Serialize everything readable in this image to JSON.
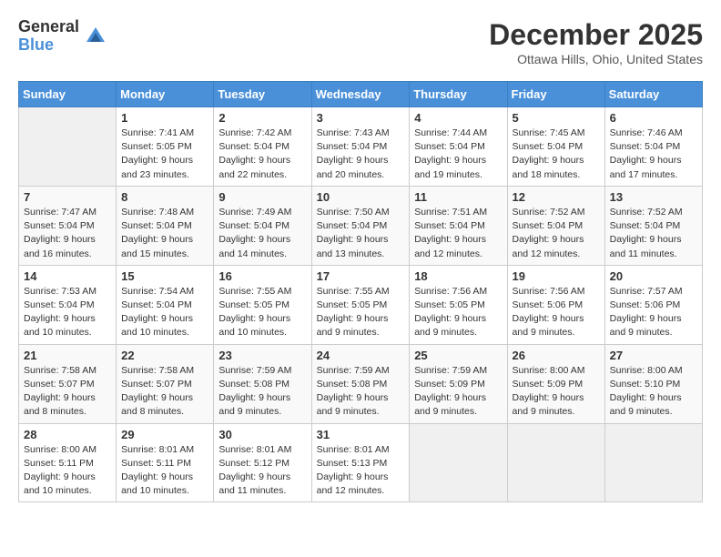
{
  "logo": {
    "general": "General",
    "blue": "Blue"
  },
  "title": "December 2025",
  "location": "Ottawa Hills, Ohio, United States",
  "weekdays": [
    "Sunday",
    "Monday",
    "Tuesday",
    "Wednesday",
    "Thursday",
    "Friday",
    "Saturday"
  ],
  "weeks": [
    [
      {
        "day": "",
        "info": ""
      },
      {
        "day": "1",
        "info": "Sunrise: 7:41 AM\nSunset: 5:05 PM\nDaylight: 9 hours\nand 23 minutes."
      },
      {
        "day": "2",
        "info": "Sunrise: 7:42 AM\nSunset: 5:04 PM\nDaylight: 9 hours\nand 22 minutes."
      },
      {
        "day": "3",
        "info": "Sunrise: 7:43 AM\nSunset: 5:04 PM\nDaylight: 9 hours\nand 20 minutes."
      },
      {
        "day": "4",
        "info": "Sunrise: 7:44 AM\nSunset: 5:04 PM\nDaylight: 9 hours\nand 19 minutes."
      },
      {
        "day": "5",
        "info": "Sunrise: 7:45 AM\nSunset: 5:04 PM\nDaylight: 9 hours\nand 18 minutes."
      },
      {
        "day": "6",
        "info": "Sunrise: 7:46 AM\nSunset: 5:04 PM\nDaylight: 9 hours\nand 17 minutes."
      }
    ],
    [
      {
        "day": "7",
        "info": "Sunrise: 7:47 AM\nSunset: 5:04 PM\nDaylight: 9 hours\nand 16 minutes."
      },
      {
        "day": "8",
        "info": "Sunrise: 7:48 AM\nSunset: 5:04 PM\nDaylight: 9 hours\nand 15 minutes."
      },
      {
        "day": "9",
        "info": "Sunrise: 7:49 AM\nSunset: 5:04 PM\nDaylight: 9 hours\nand 14 minutes."
      },
      {
        "day": "10",
        "info": "Sunrise: 7:50 AM\nSunset: 5:04 PM\nDaylight: 9 hours\nand 13 minutes."
      },
      {
        "day": "11",
        "info": "Sunrise: 7:51 AM\nSunset: 5:04 PM\nDaylight: 9 hours\nand 12 minutes."
      },
      {
        "day": "12",
        "info": "Sunrise: 7:52 AM\nSunset: 5:04 PM\nDaylight: 9 hours\nand 12 minutes."
      },
      {
        "day": "13",
        "info": "Sunrise: 7:52 AM\nSunset: 5:04 PM\nDaylight: 9 hours\nand 11 minutes."
      }
    ],
    [
      {
        "day": "14",
        "info": "Sunrise: 7:53 AM\nSunset: 5:04 PM\nDaylight: 9 hours\nand 10 minutes."
      },
      {
        "day": "15",
        "info": "Sunrise: 7:54 AM\nSunset: 5:04 PM\nDaylight: 9 hours\nand 10 minutes."
      },
      {
        "day": "16",
        "info": "Sunrise: 7:55 AM\nSunset: 5:05 PM\nDaylight: 9 hours\nand 10 minutes."
      },
      {
        "day": "17",
        "info": "Sunrise: 7:55 AM\nSunset: 5:05 PM\nDaylight: 9 hours\nand 9 minutes."
      },
      {
        "day": "18",
        "info": "Sunrise: 7:56 AM\nSunset: 5:05 PM\nDaylight: 9 hours\nand 9 minutes."
      },
      {
        "day": "19",
        "info": "Sunrise: 7:56 AM\nSunset: 5:06 PM\nDaylight: 9 hours\nand 9 minutes."
      },
      {
        "day": "20",
        "info": "Sunrise: 7:57 AM\nSunset: 5:06 PM\nDaylight: 9 hours\nand 9 minutes."
      }
    ],
    [
      {
        "day": "21",
        "info": "Sunrise: 7:58 AM\nSunset: 5:07 PM\nDaylight: 9 hours\nand 8 minutes."
      },
      {
        "day": "22",
        "info": "Sunrise: 7:58 AM\nSunset: 5:07 PM\nDaylight: 9 hours\nand 8 minutes."
      },
      {
        "day": "23",
        "info": "Sunrise: 7:59 AM\nSunset: 5:08 PM\nDaylight: 9 hours\nand 9 minutes."
      },
      {
        "day": "24",
        "info": "Sunrise: 7:59 AM\nSunset: 5:08 PM\nDaylight: 9 hours\nand 9 minutes."
      },
      {
        "day": "25",
        "info": "Sunrise: 7:59 AM\nSunset: 5:09 PM\nDaylight: 9 hours\nand 9 minutes."
      },
      {
        "day": "26",
        "info": "Sunrise: 8:00 AM\nSunset: 5:09 PM\nDaylight: 9 hours\nand 9 minutes."
      },
      {
        "day": "27",
        "info": "Sunrise: 8:00 AM\nSunset: 5:10 PM\nDaylight: 9 hours\nand 9 minutes."
      }
    ],
    [
      {
        "day": "28",
        "info": "Sunrise: 8:00 AM\nSunset: 5:11 PM\nDaylight: 9 hours\nand 10 minutes."
      },
      {
        "day": "29",
        "info": "Sunrise: 8:01 AM\nSunset: 5:11 PM\nDaylight: 9 hours\nand 10 minutes."
      },
      {
        "day": "30",
        "info": "Sunrise: 8:01 AM\nSunset: 5:12 PM\nDaylight: 9 hours\nand 11 minutes."
      },
      {
        "day": "31",
        "info": "Sunrise: 8:01 AM\nSunset: 5:13 PM\nDaylight: 9 hours\nand 12 minutes."
      },
      {
        "day": "",
        "info": ""
      },
      {
        "day": "",
        "info": ""
      },
      {
        "day": "",
        "info": ""
      }
    ]
  ]
}
